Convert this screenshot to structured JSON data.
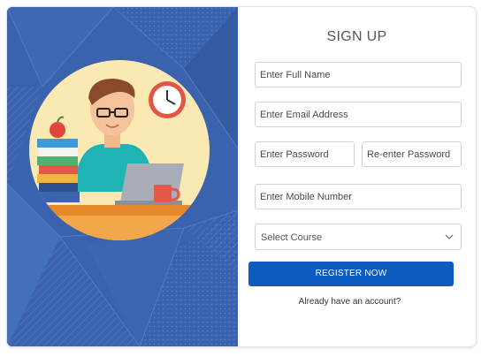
{
  "form": {
    "title": "SIGN UP",
    "full_name_placeholder": "Enter Full Name",
    "email_placeholder": "Enter Email Address",
    "password_placeholder": "Enter Password",
    "reenter_password_placeholder": "Re-enter Password",
    "mobile_placeholder": "Enter Mobile Number",
    "course_select": {
      "selected": "Select Course",
      "icon": "chevron-down-icon"
    },
    "register_label": "REGISTER NOW",
    "login_prompt": "Already have an account?"
  },
  "colors": {
    "panel_bg": "#3a62ad",
    "button_bg": "#0d5bbf",
    "illustration_circle": "#fbe9b3"
  },
  "illustration": {
    "icons": [
      "clock-icon",
      "apple-icon",
      "book-stack-icon",
      "laptop-icon",
      "mug-icon",
      "student-icon"
    ]
  }
}
